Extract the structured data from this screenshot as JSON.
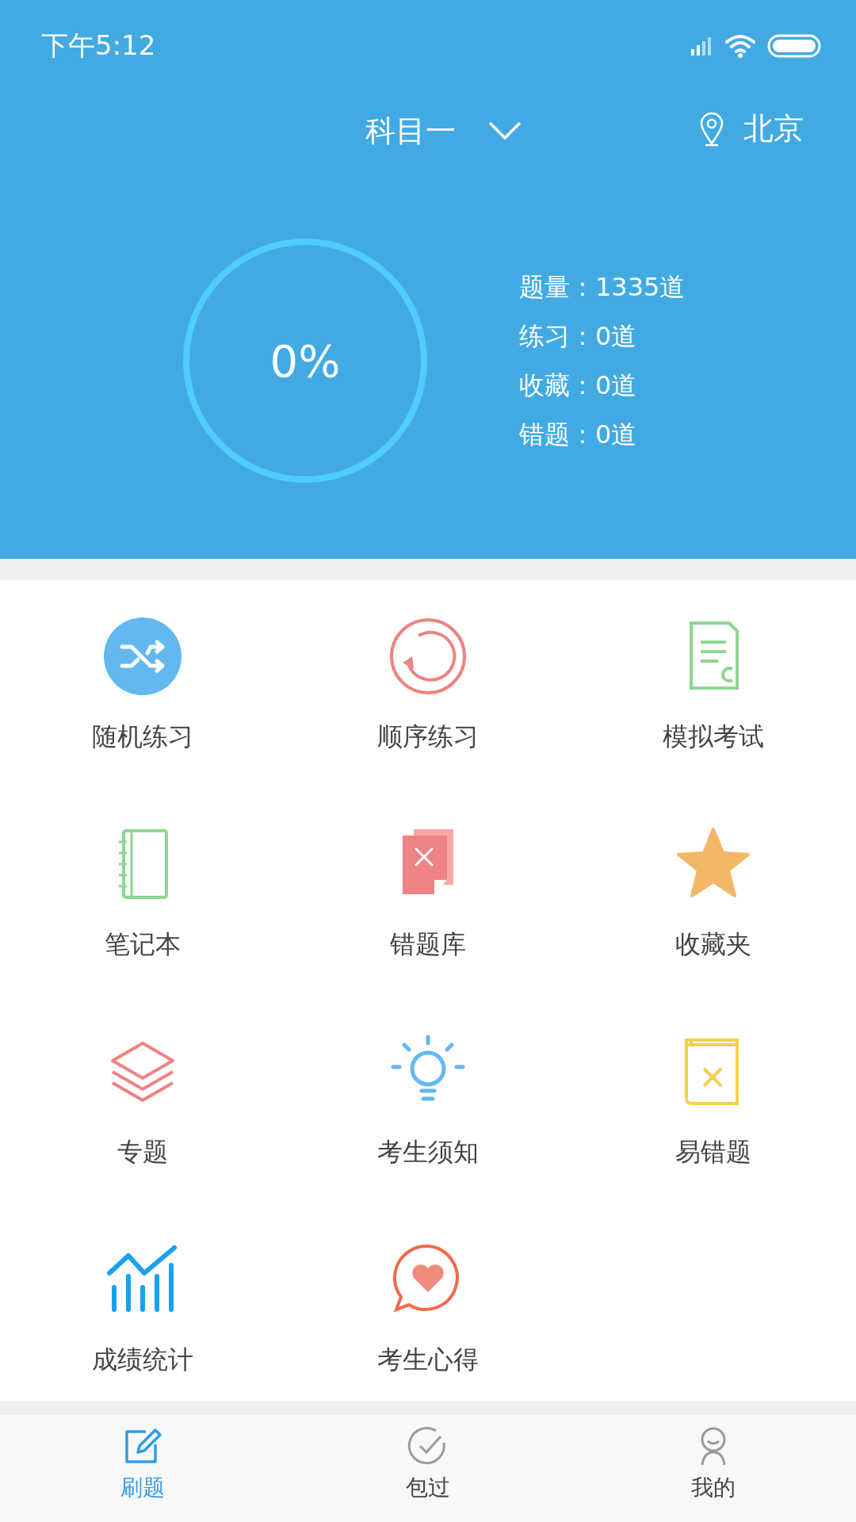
{
  "status_bar": {
    "time": "下午5:12"
  },
  "header": {
    "subject": "科目一",
    "location": "北京"
  },
  "progress": {
    "text": "0%",
    "level": 0
  },
  "stats": [
    {
      "label": "题量：",
      "value": "1335道"
    },
    {
      "label": "练习：",
      "value": "0道"
    },
    {
      "label": "收藏：",
      "value": "0道"
    },
    {
      "label": "错题：",
      "value": "0道"
    }
  ],
  "menu": [
    {
      "label": "随机练习"
    },
    {
      "label": "顺序练习"
    },
    {
      "label": "模拟考试"
    },
    {
      "label": "笔记本"
    },
    {
      "label": "错题库"
    },
    {
      "label": "收藏夹"
    },
    {
      "label": "专题"
    },
    {
      "label": "考生须知"
    },
    {
      "label": "易错题"
    },
    {
      "label": "成绩统计"
    },
    {
      "label": "考生心得"
    }
  ],
  "tabs": [
    {
      "label": "刷题",
      "selected": true
    },
    {
      "label": "包过",
      "selected": false
    },
    {
      "label": "我的",
      "selected": false
    }
  ]
}
